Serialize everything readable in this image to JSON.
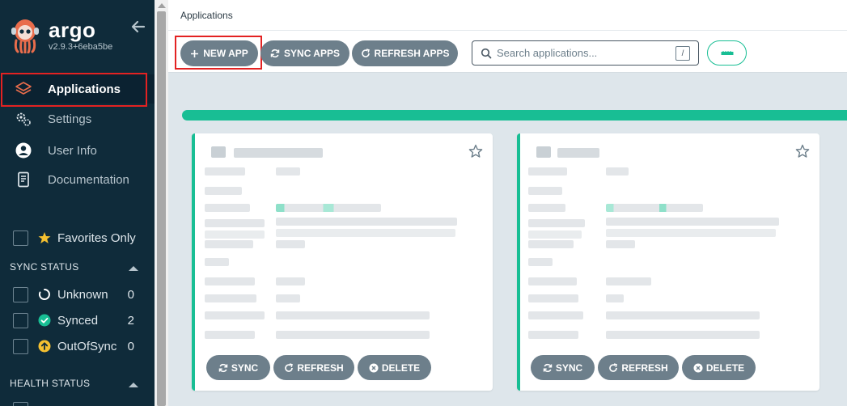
{
  "sidebar": {
    "brand": "argo",
    "version": "v2.9.3+6eba5be",
    "nav": [
      {
        "label": "Applications",
        "icon": "stack-icon"
      },
      {
        "label": "Settings",
        "icon": "gears-icon"
      },
      {
        "label": "User Info",
        "icon": "user-circle-icon"
      },
      {
        "label": "Documentation",
        "icon": "book-icon"
      }
    ],
    "favorites_label": "Favorites Only",
    "sync_status": {
      "title": "SYNC STATUS",
      "items": [
        {
          "label": "Unknown",
          "count": "0",
          "icon": "circle-notch-icon"
        },
        {
          "label": "Synced",
          "count": "2",
          "icon": "check-circle-icon"
        },
        {
          "label": "OutOfSync",
          "count": "0",
          "icon": "arrow-up-circle-icon"
        }
      ]
    },
    "health_status": {
      "title": "HEALTH STATUS"
    }
  },
  "header": {
    "title": "Applications"
  },
  "toolbar": {
    "new_app_label": "NEW APP",
    "sync_apps_label": "SYNC APPS",
    "refresh_apps_label": "REFRESH APPS",
    "search_placeholder": "Search applications...",
    "search_shortcut": "/"
  },
  "cards": [
    {
      "sync_label": "SYNC",
      "refresh_label": "REFRESH",
      "delete_label": "DELETE"
    },
    {
      "sync_label": "SYNC",
      "refresh_label": "REFRESH",
      "delete_label": "DELETE"
    }
  ],
  "colors": {
    "sidebar_bg": "#0f2b3a",
    "accent": "#18be94",
    "button_bg": "#6d7f8b",
    "highlight": "#e32222",
    "out_of_sync": "#f4c030"
  }
}
